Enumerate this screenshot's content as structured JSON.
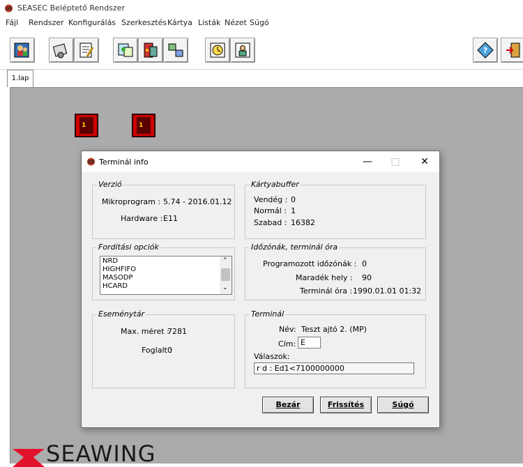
{
  "app": {
    "title": "SEASEC Beléptető Rendszer"
  },
  "menu": [
    "Fájl",
    "Rendszer",
    "Konfigurálás",
    "Szerkesztés",
    "Kártya",
    "Listák",
    "Nézet",
    "Súgó"
  ],
  "tab": {
    "label": "1.lap"
  },
  "logo": {
    "text": "SEAWING"
  },
  "door_labels": [
    "1",
    "1"
  ],
  "dialog": {
    "title": "Terminál info",
    "version": {
      "legend": "Verzió",
      "firmware_label": "Mikroprogram :",
      "firmware_value": "5.74 - 2016.01.12",
      "hardware_label": "Hardware :",
      "hardware_value": "E11"
    },
    "card_buffer": {
      "legend": "Kártyabuffer",
      "guest_label": "Vendég :",
      "guest_value": "0",
      "normal_label": "Normál :",
      "normal_value": "1",
      "free_label": "Szabad :",
      "free_value": "16382"
    },
    "compile_options": {
      "legend": "Fordítási opciók",
      "items": [
        "NRD",
        "HIGHFIFO",
        "MASODP",
        "HCARD"
      ]
    },
    "timezone": {
      "legend": "Időzónák, terminál óra",
      "programmed_label": "Programozott időzónák :",
      "programmed_value": "0",
      "remaining_label": "Maradék hely :",
      "remaining_value": "90",
      "clock_label": "Terminál óra :",
      "clock_value": "1990.01.01 01:32"
    },
    "event_store": {
      "legend": "Eseménytár",
      "max_label": "Max. méret :",
      "max_value": "7281",
      "used_label": "Foglalt :",
      "used_value": "0"
    },
    "terminal": {
      "legend": "Terminál",
      "name_label": "Név:",
      "name_value": "Teszt ajtó 2. (MP)",
      "address_label": "Cím:",
      "address_value": "E",
      "responses_label": "Válaszok:",
      "responses_value": "r d : Ed1<7100000000"
    },
    "buttons": {
      "close": "Bezár",
      "refresh": "Frissítés",
      "help": "Súgó"
    }
  },
  "colors": {
    "workspace": "#ababab",
    "door": "#d00000",
    "logo_red": "#e2142d"
  }
}
